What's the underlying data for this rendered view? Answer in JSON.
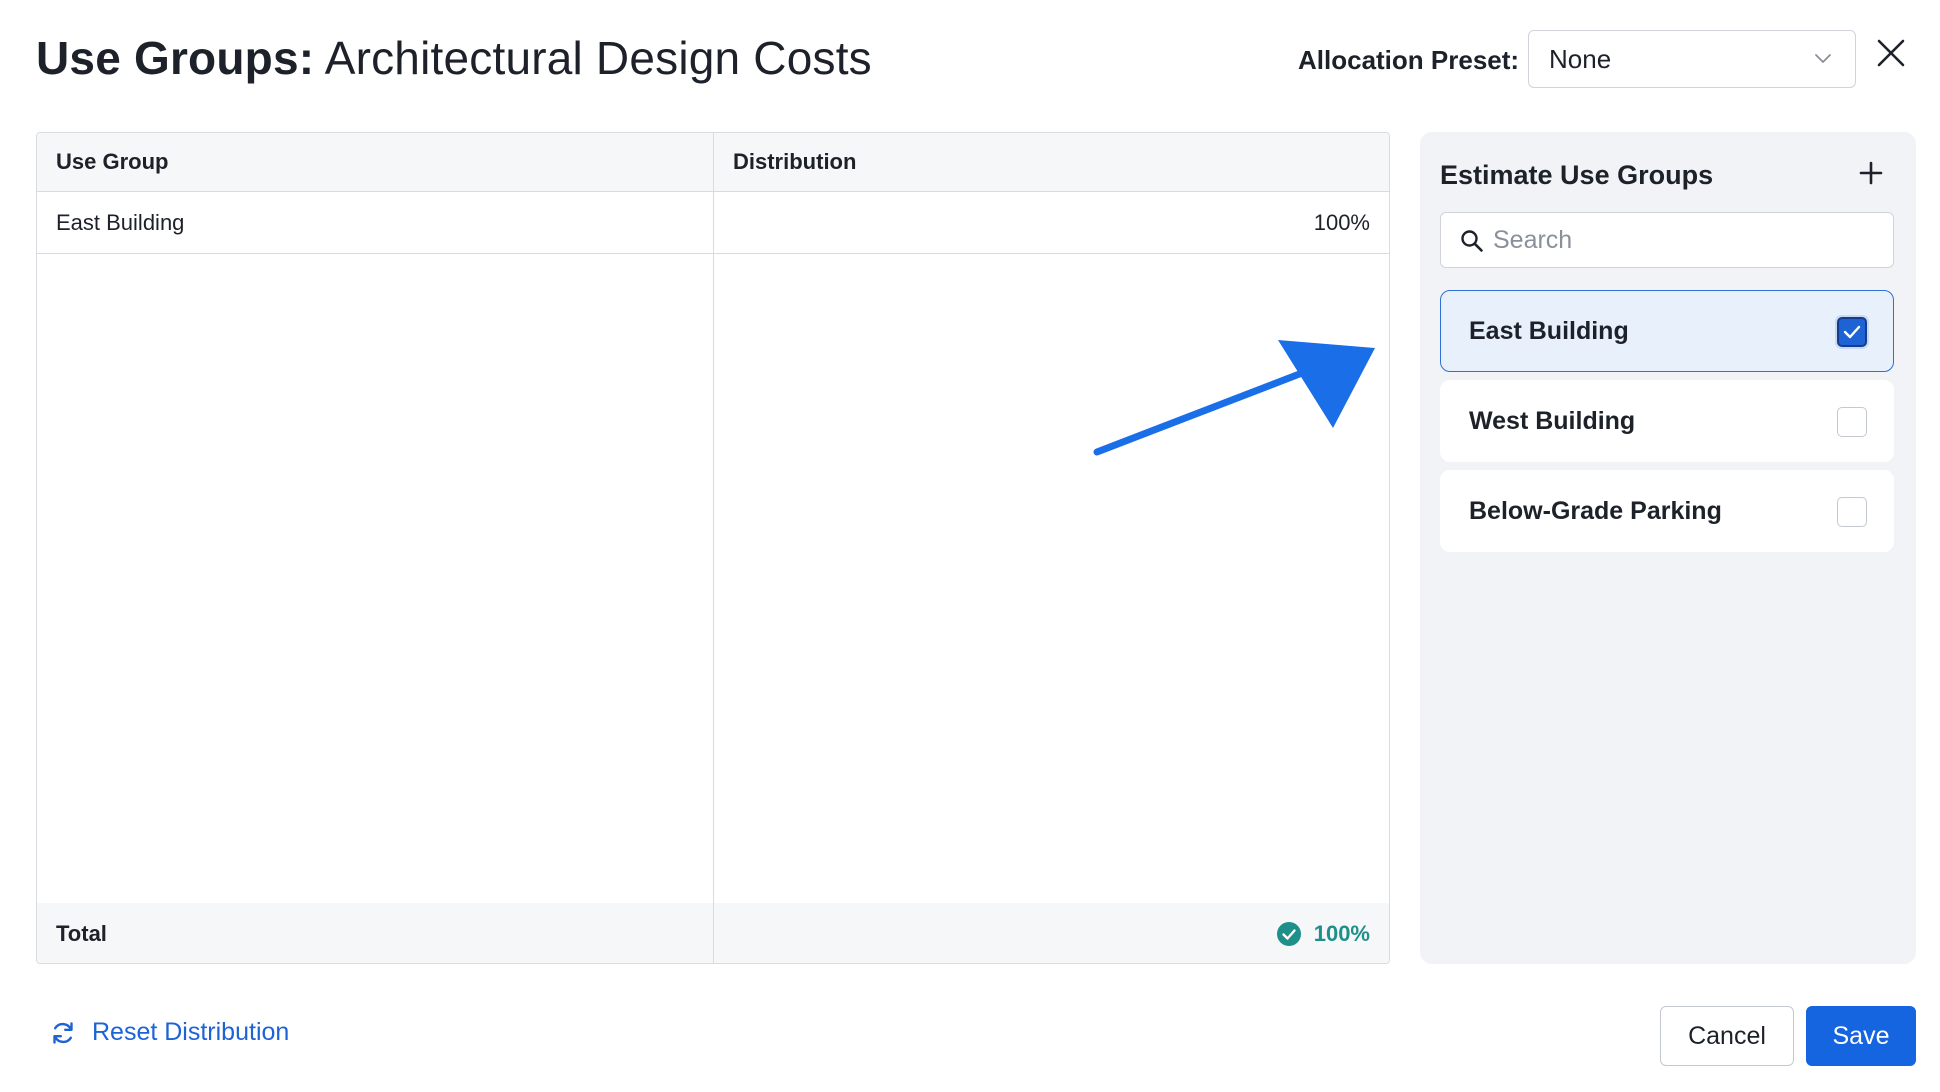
{
  "header": {
    "title_strong": "Use Groups:",
    "title_rest": "Architectural Design Costs",
    "preset_label": "Allocation Preset:",
    "preset_value": "None"
  },
  "table": {
    "columns": [
      "Use Group",
      "Distribution"
    ],
    "rows": [
      {
        "use_group": "East Building",
        "distribution": "100%"
      }
    ],
    "footer": {
      "label": "Total",
      "value": "100%"
    }
  },
  "panel": {
    "title": "Estimate Use Groups",
    "search_placeholder": "Search",
    "items": [
      {
        "label": "East Building",
        "checked": true
      },
      {
        "label": "West Building",
        "checked": false
      },
      {
        "label": "Below-Grade Parking",
        "checked": false
      }
    ]
  },
  "footer": {
    "reset_label": "Reset Distribution",
    "cancel_label": "Cancel",
    "save_label": "Save"
  },
  "icons": {
    "close": "close-icon",
    "chevron": "chevron-down-icon",
    "add": "plus-icon",
    "search": "search-icon",
    "check": "check-icon",
    "ok": "check-circle-icon",
    "reset": "refresh-icon",
    "annotation": "arrow-annotation"
  },
  "colors": {
    "accent": "#1565e0",
    "success": "#1f8f8a",
    "selected_bg": "#e8f0fc",
    "panel_bg": "#f1f3f7",
    "annotation_arrow": "#1a6ee8"
  }
}
